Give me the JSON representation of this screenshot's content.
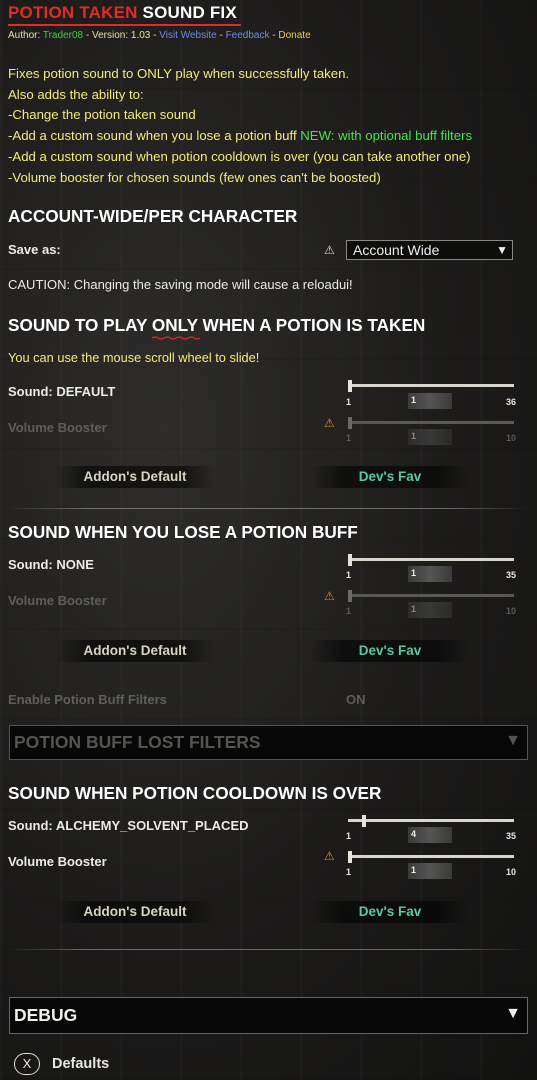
{
  "header": {
    "title_red": "POTION TAKEN",
    "title_white": "SOUND FIX",
    "author_label": "Author:",
    "author": "Trader08",
    "version_label": "Version:",
    "version": "1.03",
    "visit_link": "Visit Website",
    "feedback_link": "Feedback",
    "donate_link": "Donate"
  },
  "description": {
    "line1": "Fixes potion sound to ONLY play when successfully taken.",
    "line2": "Also adds the ability to:",
    "line3": "-Change the potion taken sound",
    "line4_prefix": "-Add a custom sound when you lose a potion buff",
    "line4_new": "NEW: with optional buff filters",
    "line5": "-Add a custom sound when potion cooldown is over (you can take another one)",
    "line6": "-Volume booster for chosen sounds (few ones can't be boosted)"
  },
  "account": {
    "heading": "ACCOUNT-WIDE/PER CHARACTER",
    "save_as_label": "Save as:",
    "save_as_value": "Account Wide",
    "caution": "CAUTION: Changing the saving mode will cause a reloadui!"
  },
  "taken": {
    "heading": "SOUND TO PLAY ONLY WHEN A POTION IS TAKEN",
    "hint": "You can use the mouse scroll wheel to slide!",
    "sound_label": "Sound: DEFAULT",
    "sound_min": "1",
    "sound_val": "1",
    "sound_max": "36",
    "sound_fraction": 0.0,
    "booster_label": "Volume Booster",
    "booster_min": "1",
    "booster_val": "1",
    "booster_max": "10",
    "booster_fraction": 0.0,
    "addon_default": "Addon's Default",
    "dev_fav": "Dev's Fav"
  },
  "lose": {
    "heading": "SOUND WHEN YOU LOSE A POTION BUFF",
    "sound_label": "Sound: NONE",
    "sound_min": "1",
    "sound_val": "1",
    "sound_max": "35",
    "sound_fraction": 0.0,
    "booster_label": "Volume Booster",
    "booster_min": "1",
    "booster_val": "1",
    "booster_max": "10",
    "booster_fraction": 0.0,
    "addon_default": "Addon's Default",
    "dev_fav": "Dev's Fav",
    "filters_label": "Enable Potion Buff Filters",
    "filters_value": "ON",
    "filters_dropdown": "POTION BUFF LOST FILTERS"
  },
  "cooldown": {
    "heading": "SOUND WHEN POTION COOLDOWN IS OVER",
    "sound_label": "Sound: ALCHEMY_SOLVENT_PLACED",
    "sound_min": "1",
    "sound_val": "4",
    "sound_max": "35",
    "sound_fraction": 0.088,
    "booster_label": "Volume Booster",
    "booster_min": "1",
    "booster_val": "1",
    "booster_max": "10",
    "booster_fraction": 0.0,
    "addon_default": "Addon's Default",
    "dev_fav": "Dev's Fav"
  },
  "debug": {
    "heading": "DEBUG"
  },
  "footer": {
    "key": "X",
    "defaults": "Defaults"
  },
  "colors": {
    "title_red": "#e22b22",
    "desc_yellow": "#f2ec78",
    "new_green": "#45e545",
    "fav_teal": "#5ac8a0",
    "warning_orange": "#d98a2a"
  },
  "icons": {
    "dropdown": "triangle-down",
    "warning": "warning-triangle"
  }
}
